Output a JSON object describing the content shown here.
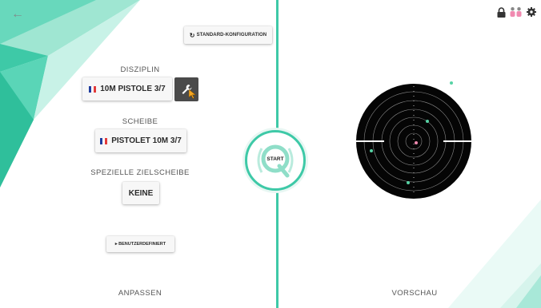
{
  "header": {
    "back_icon": "arrow-left-icon",
    "status_icons": [
      "lock-icon",
      "users-icon",
      "gear-icon"
    ]
  },
  "left_panel": {
    "standard_config_label": "STANDARD-KONFIGURATION",
    "discipline": {
      "label": "DISZIPLIN",
      "value": "10M PISTOLE 3/7",
      "flag": "france"
    },
    "target": {
      "label": "SCHEIBE",
      "value": "PISTOLET 10M 3/7",
      "flag": "france"
    },
    "special_target": {
      "label": "SPEZIELLE ZIELSCHEIBE",
      "value": "KEINE"
    },
    "custom_label": "▸ BENUTZERDEFINIERT",
    "footer_label": "ANPASSEN"
  },
  "start_button": {
    "label": "START"
  },
  "right_panel": {
    "footer_label": "VORSCHAU"
  },
  "colors": {
    "accent": "#3ec9a7",
    "target_black": "#050505",
    "flag_blue": "#1f3c9e",
    "flag_red": "#e23a3a",
    "shot_green": "#57d3a5",
    "shot_pink": "#f08ab0"
  }
}
